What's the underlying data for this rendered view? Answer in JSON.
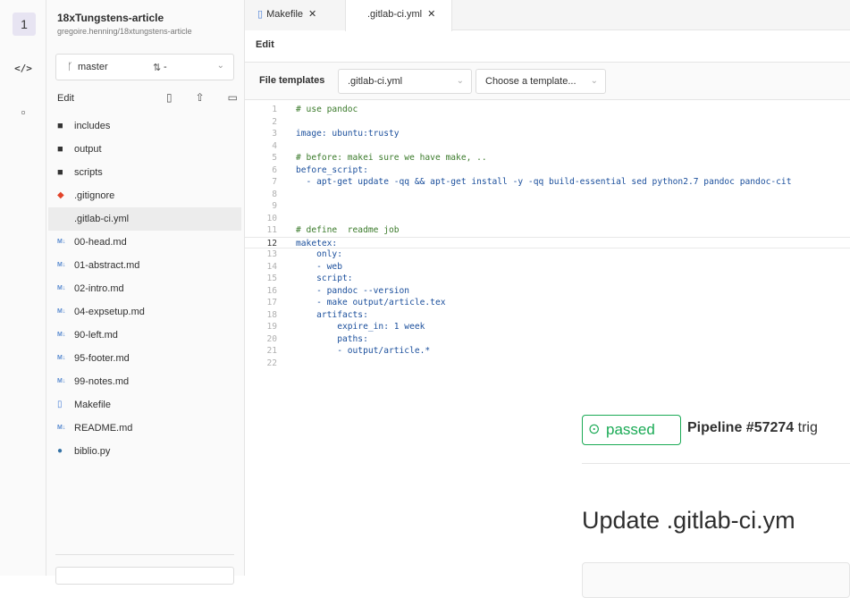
{
  "rail": {
    "project_initial": "1",
    "code_icon": "</>",
    "square_icon": "▫"
  },
  "project": {
    "name": "18xTungstens-article",
    "path": "gregoire.henning/18xtungstens-article"
  },
  "branch": {
    "name": "master",
    "mr": "-"
  },
  "tree": {
    "edit_label": "Edit",
    "items": [
      {
        "icon": "folder-icon",
        "label": "includes"
      },
      {
        "icon": "folder-icon",
        "label": "output"
      },
      {
        "icon": "folder-icon",
        "label": "scripts"
      },
      {
        "icon": "git-icon",
        "label": ".gitignore"
      },
      {
        "icon": "none",
        "label": ".gitlab-ci.yml"
      },
      {
        "icon": "markdown-icon",
        "label": "00-head.md"
      },
      {
        "icon": "markdown-icon",
        "label": "01-abstract.md"
      },
      {
        "icon": "markdown-icon",
        "label": "02-intro.md"
      },
      {
        "icon": "markdown-icon",
        "label": "04-expsetup.md"
      },
      {
        "icon": "markdown-icon",
        "label": "90-left.md"
      },
      {
        "icon": "markdown-icon",
        "label": "95-footer.md"
      },
      {
        "icon": "markdown-icon",
        "label": "99-notes.md"
      },
      {
        "icon": "file-icon",
        "label": "Makefile"
      },
      {
        "icon": "markdown-icon",
        "label": "README.md"
      },
      {
        "icon": "python-icon",
        "label": "biblio.py"
      }
    ]
  },
  "tabs": [
    {
      "label": "Makefile"
    },
    {
      "label": ".gitlab-ci.yml"
    }
  ],
  "editor": {
    "mode_tab": "Edit",
    "templates_label": "File templates",
    "template_type": ".gitlab-ci.yml",
    "template_choice": "Choose a template...",
    "lines": [
      "# use pandoc",
      "",
      "image: ubuntu:trusty",
      "",
      "# before: makei sure we have make, ..",
      "before_script:",
      "  - apt-get update -qq && apt-get install -y -qq build-essential sed python2.7 pandoc pandoc-cit",
      "",
      "",
      "",
      "# define  readme job",
      "maketex:",
      "    only:",
      "    - web",
      "    script:",
      "    - pandoc --version",
      "    - make output/article.tex",
      "    artifacts:",
      "        expire_in: 1 week",
      "        paths:",
      "        - output/article.*",
      ""
    ]
  },
  "pipeline": {
    "status": "passed",
    "text_bold": "Pipeline #57274",
    "text_rest": " trig",
    "commit_title": "Update .gitlab-ci.ym"
  }
}
